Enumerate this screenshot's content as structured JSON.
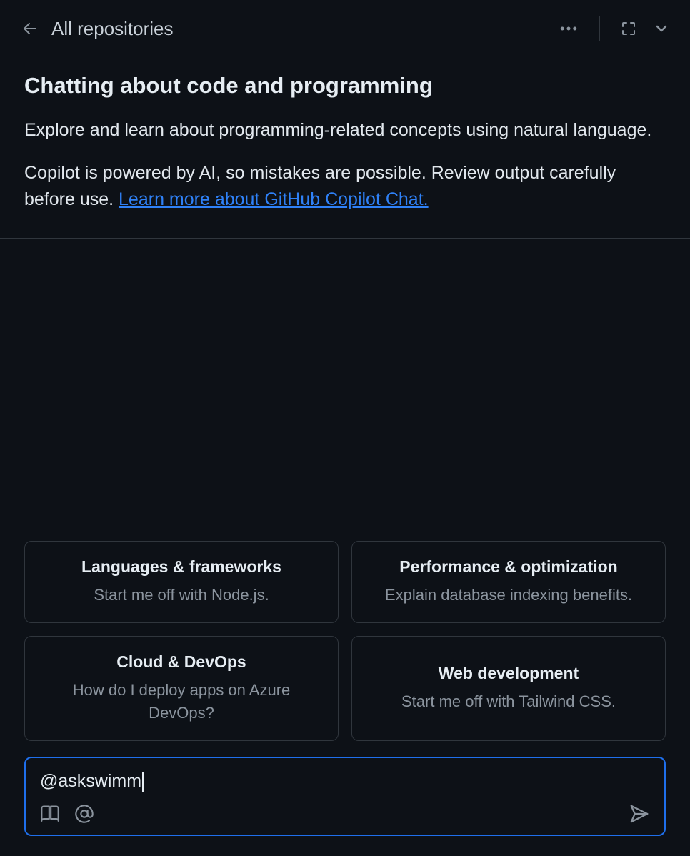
{
  "header": {
    "title": "All repositories"
  },
  "intro": {
    "title": "Chatting about code and programming",
    "p1": "Explore and learn about programming-related concepts using natural language.",
    "p2_prefix": "Copilot is powered by AI, so mistakes are possible. Review output carefully before use. ",
    "learn_link": "Learn more about GitHub Copilot Chat."
  },
  "suggestions": [
    {
      "title": "Languages & frameworks",
      "desc": "Start me off with Node.js."
    },
    {
      "title": "Performance & optimization",
      "desc": "Explain database indexing benefits."
    },
    {
      "title": "Cloud & DevOps",
      "desc": "How do I deploy apps on Azure DevOps?"
    },
    {
      "title": "Web development",
      "desc": "Start me off with Tailwind CSS."
    }
  ],
  "input": {
    "value": "@askswimm"
  }
}
